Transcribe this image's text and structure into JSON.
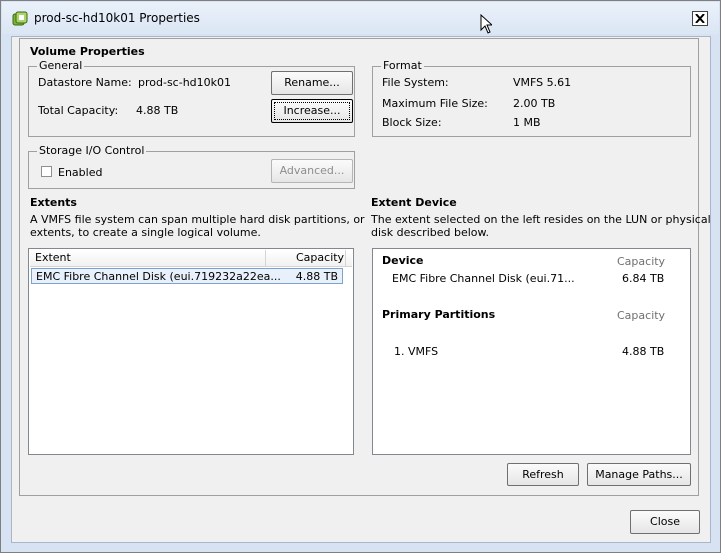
{
  "window": {
    "title": "prod-sc-hd10k01 Properties"
  },
  "volume_properties": {
    "heading": "Volume Properties",
    "general": {
      "legend": "General",
      "datastore_name_label": "Datastore Name:",
      "datastore_name_value": "prod-sc-hd10k01",
      "total_capacity_label": "Total Capacity:",
      "total_capacity_value": "4.88 TB",
      "rename_button": "Rename...",
      "increase_button": "Increase..."
    },
    "format": {
      "legend": "Format",
      "file_system_label": "File System:",
      "file_system_value": "VMFS 5.61",
      "max_file_size_label": "Maximum File Size:",
      "max_file_size_value": "2.00 TB",
      "block_size_label": "Block Size:",
      "block_size_value": "1 MB"
    },
    "storage_io": {
      "legend": "Storage I/O Control",
      "enabled_label": "Enabled",
      "advanced_button": "Advanced..."
    }
  },
  "extents": {
    "heading": "Extents",
    "description_line1": "A VMFS file system can span multiple hard disk partitions, or",
    "description_line2": "extents, to create a single logical volume.",
    "columns": [
      "Extent",
      "Capacity"
    ],
    "rows": [
      {
        "extent": "EMC Fibre Channel Disk (eui.719232a22ea...",
        "capacity": "4.88 TB"
      }
    ]
  },
  "extent_device": {
    "heading": "Extent Device",
    "description_line1": "The extent selected on the left resides on the LUN or physical",
    "description_line2": "disk described below.",
    "device_heading": "Device",
    "capacity_heading": "Capacity",
    "device_name": "EMC Fibre Channel Disk (eui.71...",
    "device_capacity": "6.84 TB",
    "partitions_heading": "Primary Partitions",
    "partitions_capacity_heading": "Capacity",
    "partition_name": "1. VMFS",
    "partition_capacity": "4.88 TB"
  },
  "buttons": {
    "refresh": "Refresh",
    "manage_paths": "Manage Paths...",
    "close": "Close"
  },
  "colors": {
    "accent": "#7da2ce",
    "titlebar": "#dbe6f4"
  }
}
